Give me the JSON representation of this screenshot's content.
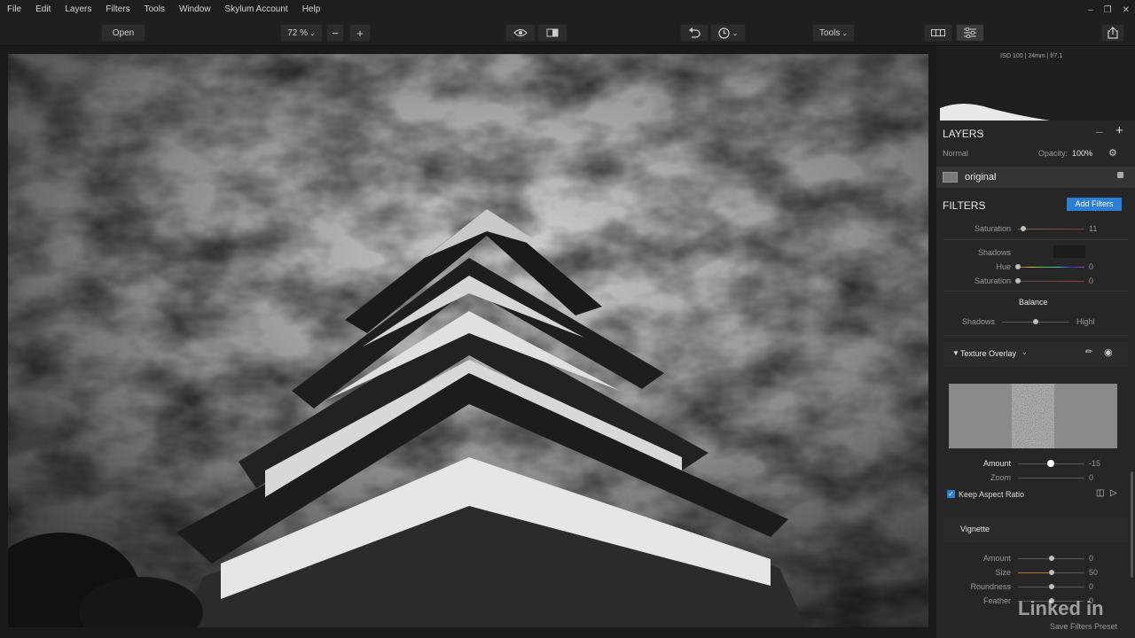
{
  "menu": [
    "File",
    "Edit",
    "Layers",
    "Filters",
    "Tools",
    "Window",
    "Skylum Account",
    "Help"
  ],
  "toolbar": {
    "open_label": "Open",
    "zoom": "72 %",
    "tools_label": "Tools"
  },
  "histogram": {
    "info": "ISO 100 | 24mm | f/7.1"
  },
  "layers": {
    "title": "LAYERS",
    "blend_mode": "Normal",
    "opacity_label": "Opacity:",
    "opacity_value": "100%",
    "layer_name": "original"
  },
  "filters": {
    "title": "FILTERS",
    "add_label": "Add Filters",
    "saturation_top": {
      "label": "Saturation",
      "value": "11"
    },
    "shadows_group": {
      "label": "Shadows",
      "hue": {
        "label": "Hue",
        "value": "0"
      },
      "saturation": {
        "label": "Saturation",
        "value": "0"
      }
    },
    "balance": {
      "label": "Balance",
      "left": "Shadows",
      "right": "Highl"
    },
    "texture": {
      "title": "Texture Overlay",
      "amount": {
        "label": "Amount",
        "value": "-15"
      },
      "zoom": {
        "label": "Zoom",
        "value": "0"
      },
      "keep_aspect": "Keep Aspect Ratio"
    },
    "vignette": {
      "title": "Vignette",
      "amount": {
        "label": "Amount",
        "value": "0"
      },
      "size": {
        "label": "Size",
        "value": "50"
      },
      "roundness": {
        "label": "Roundness",
        "value": "0"
      },
      "feather": {
        "label": "Feather",
        "value": "0"
      }
    }
  },
  "footer": {
    "save_preset": "Save Filters Preset"
  },
  "watermark": {
    "brand": "Linked in"
  },
  "slider_levels": {
    "saturation_top": 0.11,
    "hue": 0.0,
    "sat_shadows": 0.0,
    "balance": 0.5,
    "tex_amount": -0.15,
    "tex_zoom": 0.0,
    "vig_amount": 0.0,
    "vig_size": 0.5,
    "vig_round": 0.0,
    "vig_feather": 0.0
  },
  "colors": {
    "accent": "#2a7fd4",
    "bg": "#262626"
  }
}
